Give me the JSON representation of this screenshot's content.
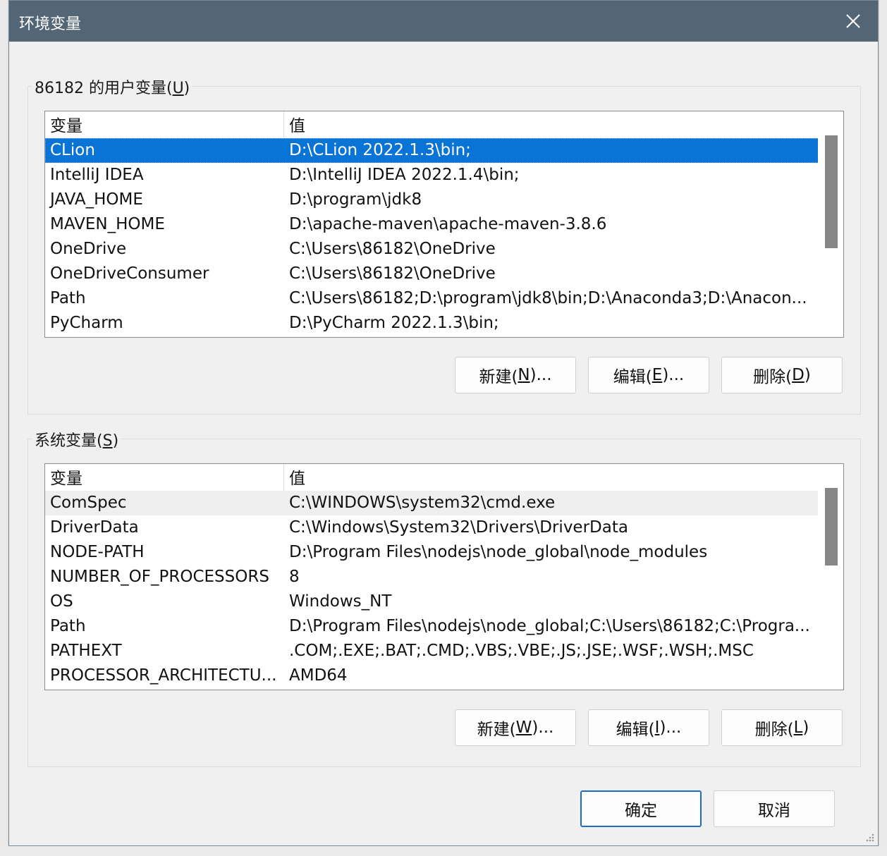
{
  "window": {
    "title": "环境变量",
    "close_icon": "close-icon"
  },
  "user_vars": {
    "label_prefix": "86182 的用户变量(",
    "label_key": "U",
    "label_suffix": ")",
    "columns": [
      "变量",
      "值"
    ],
    "rows": [
      {
        "name": "CLion",
        "value": "D:\\CLion 2022.1.3\\bin;",
        "selected": true
      },
      {
        "name": "IntelliJ IDEA",
        "value": "D:\\IntelliJ IDEA 2022.1.4\\bin;"
      },
      {
        "name": "JAVA_HOME",
        "value": "D:\\program\\jdk8"
      },
      {
        "name": "MAVEN_HOME",
        "value": "D:\\apache-maven\\apache-maven-3.8.6"
      },
      {
        "name": "OneDrive",
        "value": "C:\\Users\\86182\\OneDrive"
      },
      {
        "name": "OneDriveConsumer",
        "value": "C:\\Users\\86182\\OneDrive"
      },
      {
        "name": "Path",
        "value": "C:\\Users\\86182;D:\\program\\jdk8\\bin;D:\\Anaconda3;D:\\Anacon..."
      },
      {
        "name": "PyCharm",
        "value": "D:\\PyCharm 2022.1.3\\bin;"
      }
    ],
    "buttons": {
      "new": {
        "prefix": "新建(",
        "key": "N",
        "suffix": ")..."
      },
      "edit": {
        "prefix": "编辑(",
        "key": "E",
        "suffix": ")..."
      },
      "delete": {
        "prefix": "删除(",
        "key": "D",
        "suffix": ")"
      }
    }
  },
  "system_vars": {
    "label_prefix": "系统变量(",
    "label_key": "S",
    "label_suffix": ")",
    "columns": [
      "变量",
      "值"
    ],
    "rows": [
      {
        "name": "ComSpec",
        "value": "C:\\WINDOWS\\system32\\cmd.exe",
        "hover": true
      },
      {
        "name": "DriverData",
        "value": "C:\\Windows\\System32\\Drivers\\DriverData"
      },
      {
        "name": "NODE-PATH",
        "value": "D:\\Program Files\\nodejs\\node_global\\node_modules"
      },
      {
        "name": "NUMBER_OF_PROCESSORS",
        "value": "8"
      },
      {
        "name": "OS",
        "value": "Windows_NT"
      },
      {
        "name": "Path",
        "value": "D:\\Program Files\\nodejs\\node_global;C:\\Users\\86182;C:\\Progra..."
      },
      {
        "name": "PATHEXT",
        "value": ".COM;.EXE;.BAT;.CMD;.VBS;.VBE;.JS;.JSE;.WSF;.WSH;.MSC"
      },
      {
        "name": "PROCESSOR_ARCHITECTU...",
        "value": "AMD64"
      }
    ],
    "buttons": {
      "new": {
        "prefix": "新建(",
        "key": "W",
        "suffix": ")..."
      },
      "edit": {
        "prefix": "编辑(",
        "key": "I",
        "suffix": ")..."
      },
      "delete": {
        "prefix": "删除(",
        "key": "L",
        "suffix": ")"
      }
    }
  },
  "footer": {
    "ok": "确定",
    "cancel": "取消"
  },
  "colors": {
    "titlebar": "#526675",
    "selection": "#0a73d6",
    "scroll_thumb": "#868686"
  }
}
